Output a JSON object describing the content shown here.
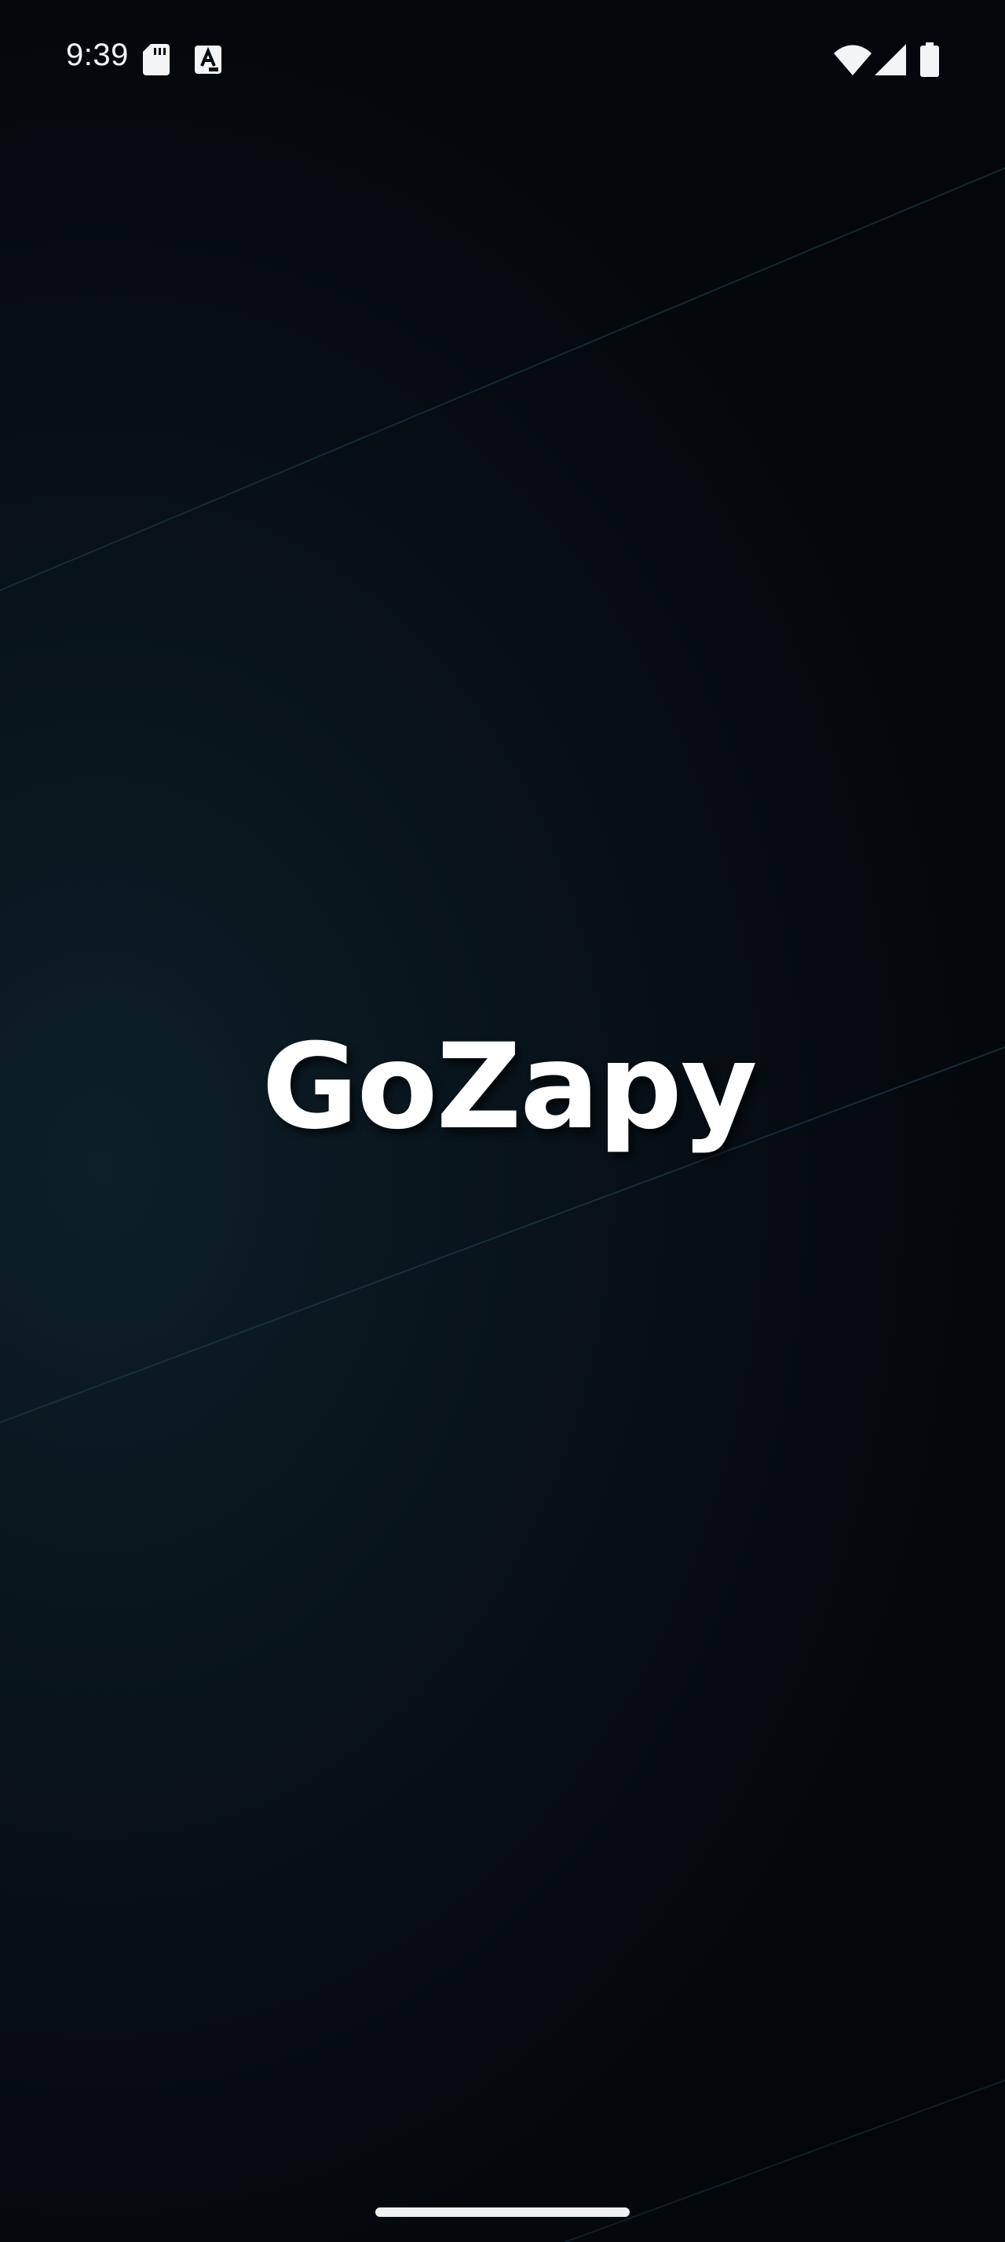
{
  "status_bar": {
    "time": "9:39",
    "icons": [
      "sd-card-icon",
      "a-notification-icon",
      "wifi-icon",
      "cellular-signal-icon",
      "battery-icon"
    ]
  },
  "splash": {
    "logo_text": "GoZapy"
  },
  "colors": {
    "background_dark": "#03070b",
    "background_glow": "#0d1f28",
    "accent_line": "#163040",
    "logo_text": "#ffffff"
  },
  "navigation": {
    "gesture": "home-indicator"
  }
}
